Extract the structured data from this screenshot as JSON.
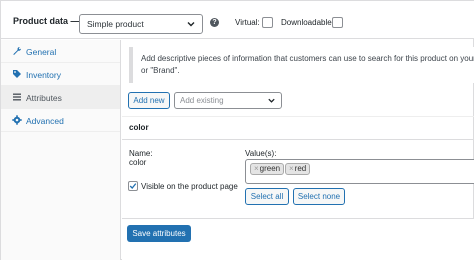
{
  "header": {
    "title": "Product data —",
    "product_type": "Simple product",
    "help_glyph": "?",
    "virtual_label": "Virtual:",
    "downloadable_label": "Downloadable:"
  },
  "sidebar": {
    "items": [
      {
        "label": "General",
        "icon": "wrench-icon"
      },
      {
        "label": "Inventory",
        "icon": "tag-icon"
      },
      {
        "label": "Attributes",
        "icon": "list-icon"
      },
      {
        "label": "Advanced",
        "icon": "gear-icon"
      }
    ],
    "active": "Attributes"
  },
  "main": {
    "notice_line1": "Add descriptive pieces of information that customers can use to search for this product on your st",
    "notice_line2": "or \"Brand\".",
    "add_new_label": "Add new",
    "add_existing_placeholder": "Add existing",
    "attribute_heading": "color",
    "name_label": "Name:",
    "name_value": "color",
    "values_label": "Value(s):",
    "values": [
      "green",
      "red"
    ],
    "chip_remove_glyph": "×",
    "visible_label": "Visible on the product page",
    "visible_checked": true,
    "select_all_label": "Select all",
    "select_none_label": "Select none",
    "save_label": "Save attributes"
  },
  "colors": {
    "accent": "#2271b1",
    "border": "#dcdcde",
    "sidebar_bg": "#fafafa"
  }
}
